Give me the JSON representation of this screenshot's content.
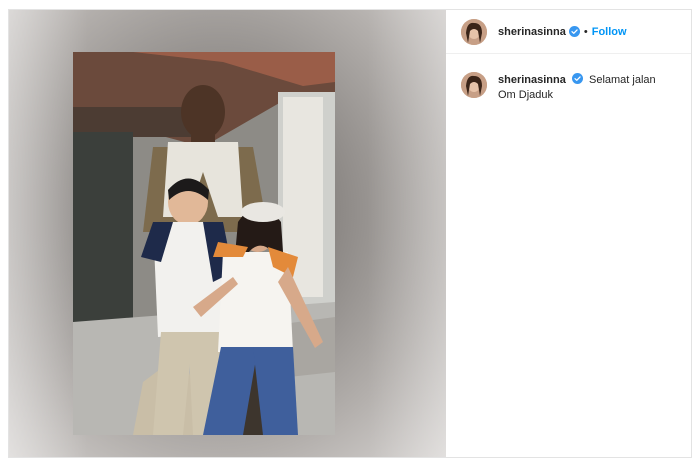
{
  "post": {
    "username": "sherinasinna",
    "separator": "•",
    "follow_label": "Follow",
    "caption": {
      "username": "sherinasinna",
      "text": "Selamat jalan Om Djaduk"
    }
  },
  "colors": {
    "follow": "#0095f6",
    "verified": "#3897f0",
    "text": "#262626"
  },
  "icons": {
    "verified": "verified-badge-icon"
  }
}
